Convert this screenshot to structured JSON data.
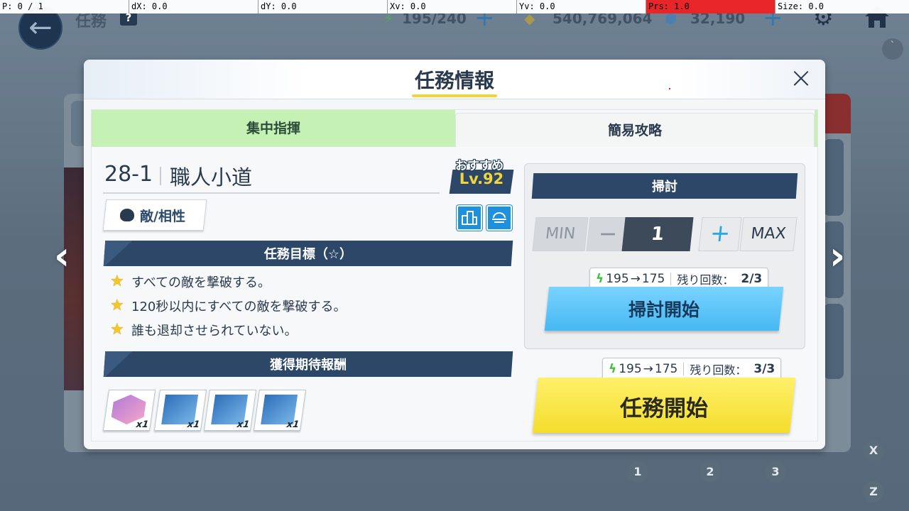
{
  "debug": {
    "pointer": "P: 0 / 1",
    "dx": "dX: 0.0",
    "dy": "dY: 0.0",
    "xv": "Xv: 0.0",
    "yv": "Yv: 0.0",
    "prs": "Prs: 1.0",
    "size": "Size: 0.0"
  },
  "topbar": {
    "title": "任務",
    "help": "?",
    "ap": "195/240",
    "credits": "540,769,064",
    "gems": "32,190"
  },
  "modal": {
    "title": "任務情報",
    "close": "×",
    "tabs": [
      {
        "label": "集中指揮"
      },
      {
        "label": "簡易攻略"
      }
    ],
    "stage_number": "28-1",
    "stage_name": "職人小道",
    "recommended_label": "おすすめ",
    "recommended_level": "Lv.92",
    "enemy_button": "敵/相性",
    "objectives_header": "任務目標（☆）",
    "objectives": [
      "すべての敵を撃破する。",
      "120秒以内にすべての敵を撃破する。",
      "誰も退却させられていない。"
    ],
    "rewards_header": "獲得期待報酬",
    "rewards": [
      {
        "count": "x1"
      },
      {
        "count": "x1"
      },
      {
        "count": "x1"
      },
      {
        "count": "x1"
      }
    ],
    "sweep": {
      "header": "掃討",
      "min": "MIN",
      "minus": "—",
      "value": "1",
      "plus": "+",
      "max": "MAX",
      "cost": "195",
      "arrow": "→",
      "cost_after": "175",
      "remain_label": "残り回数：",
      "remain": "2/3",
      "button": "掃討開始"
    },
    "mission": {
      "cost": "195",
      "arrow": "→",
      "cost_after": "175",
      "remain_label": "残り回数：",
      "remain": "3/3",
      "button": "任務開始"
    }
  },
  "nav": {
    "prev": "‹",
    "next": "›"
  },
  "overlay_buttons": {
    "x": "X",
    "z": "Z",
    "one": "1",
    "two": "2",
    "three": "3",
    "backtick": "`"
  },
  "colors": {
    "accent_yellow": "#f4dd2c",
    "accent_blue": "#46b8f3",
    "navy": "#2c4768",
    "tab_active": "#c5f1b4"
  }
}
